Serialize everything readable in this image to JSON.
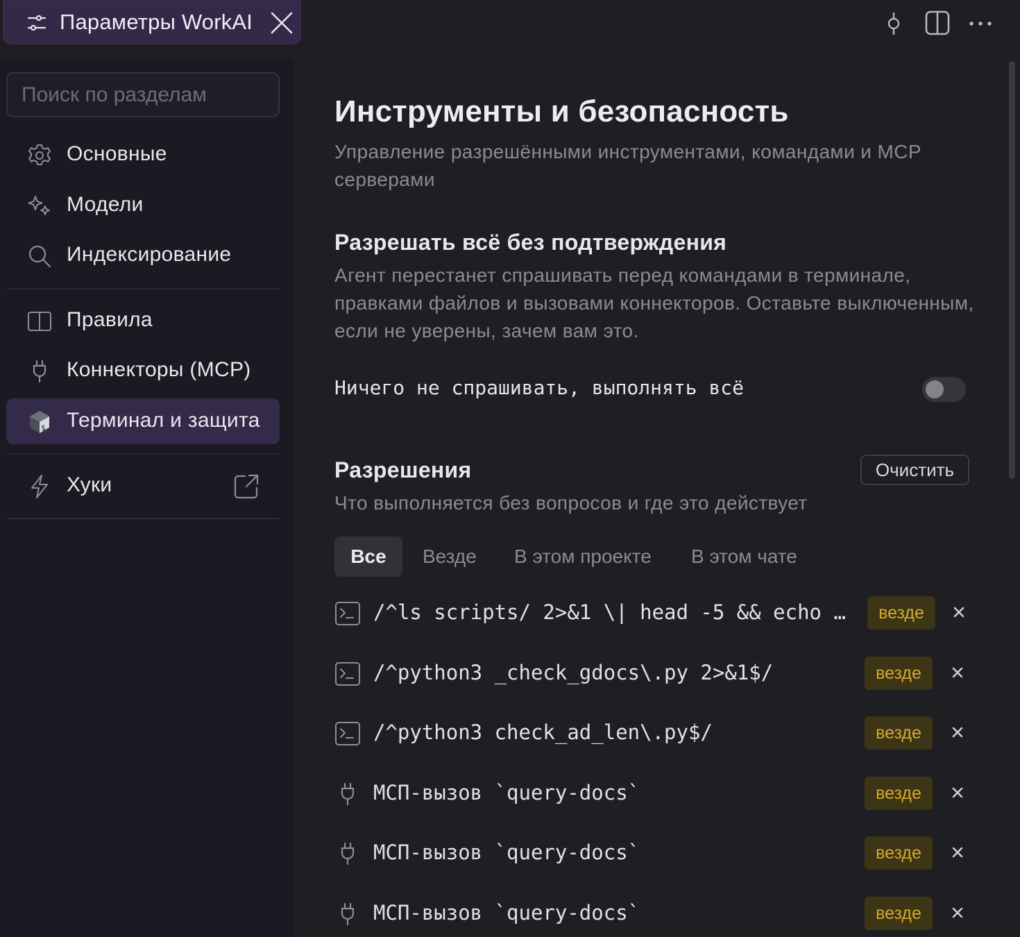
{
  "tab": {
    "title": "Параметры WorkAI"
  },
  "sidebar": {
    "search_placeholder": "Поиск по разделам",
    "items": [
      {
        "label": "Основные",
        "icon": "gear-icon"
      },
      {
        "label": "Модели",
        "icon": "sparkle-icon"
      },
      {
        "label": "Индексирование",
        "icon": "search-icon"
      },
      {
        "label": "Правила",
        "icon": "book-icon"
      },
      {
        "label": "Коннекторы (MCP)",
        "icon": "plug-icon"
      },
      {
        "label": "Терминал и защита",
        "icon": "terminal-shield-icon",
        "active": true
      },
      {
        "label": "Хуки",
        "icon": "lightning-icon"
      }
    ]
  },
  "main": {
    "title": "Инструменты и безопасность",
    "subtitle": "Управление разрешёнными инструментами, командами и MCP серверами",
    "auto_section": {
      "title": "Разрешать всё без подтверждения",
      "description": "Агент перестанет спрашивать перед командами в терминале, правками файлов и вызовами коннекторов. Оставьте выключенным, если не уверены, зачем вам это.",
      "toggle_label": "Ничего не спрашивать, выполнять всё",
      "toggle_on": false
    },
    "permissions": {
      "title": "Разрешения",
      "subtitle": "Что выполняется без вопросов и где это действует",
      "clear_label": "Очистить",
      "filters": [
        "Все",
        "Везде",
        "В этом проекте",
        "В этом чате"
      ],
      "active_filter": "Все",
      "rows": [
        {
          "icon": "terminal-icon",
          "text": "/^ls scripts/ 2>&1 \\| head -5 && echo …",
          "scope": "везде"
        },
        {
          "icon": "terminal-icon",
          "text": "/^python3 _check_gdocs\\.py 2>&1$/",
          "scope": "везде"
        },
        {
          "icon": "terminal-icon",
          "text": "/^python3 check_ad_len\\.py$/",
          "scope": "везде"
        },
        {
          "icon": "plug-icon",
          "text": "МСП-вызов `query-docs`",
          "scope": "везде"
        },
        {
          "icon": "plug-icon",
          "text": "МСП-вызов `query-docs`",
          "scope": "везде"
        },
        {
          "icon": "plug-icon",
          "text": "МСП-вызов `query-docs`",
          "scope": "везде"
        }
      ]
    }
  },
  "colors": {
    "accent": "#342a4a",
    "badge_bg": "#3c3516",
    "badge_text": "#d6a92d"
  }
}
